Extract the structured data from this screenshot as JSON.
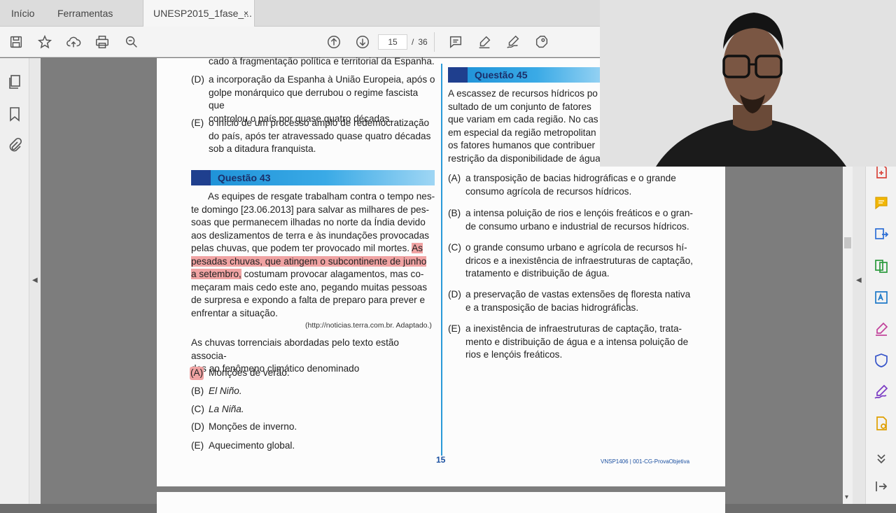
{
  "tabs": {
    "home": "Início",
    "tools": "Ferramentas",
    "document": "UNESP2015_1fase_...",
    "close": "×"
  },
  "toolbar": {
    "page_current": "15",
    "page_sep": "/",
    "page_total": "36"
  },
  "left_column": {
    "top_line": "cado à fragmentação política e territorial da Espanha.",
    "opt_d_label": "(D)",
    "opt_d_lines": [
      "a incorporação da Espanha à União Europeia, após o",
      "golpe monárquico que derrubou o regime fascista que",
      "controlou o país por quase quatro décadas."
    ],
    "opt_e_label": "(E)",
    "opt_e_lines": [
      "o início de um processo amplo de redemocratização",
      "do país, após ter atravessado quase quatro décadas",
      "sob a ditadura franquista."
    ],
    "question_title": "Questão 43",
    "passage_1": "As equipes de resgate trabalham contra o tempo nes-",
    "passage_2": "te domingo [23.06.2013] para salvar as milhares de pes-",
    "passage_3": "soas que permanecem ilhadas no norte da Índia devido",
    "passage_4": "aos deslizamentos de terra e às inundações provocadas",
    "passage_5a": "pelas chuvas, que podem ter provocado mil mortes.",
    "passage_5b": "As",
    "passage_6": "pesadas chuvas, que atingem o subcontinente de junho",
    "passage_7a": "a setembro,",
    "passage_7b": "costumam provocar alagamentos, mas co-",
    "passage_8": "meçaram mais cedo este ano, pegando muitas pessoas",
    "passage_9": "de surpresa e expondo a falta de preparo para prever e",
    "passage_10": "enfrentar a situação.",
    "source": "(http://noticias.terra.com.br. Adaptado.)",
    "stem_1": "As chuvas torrenciais abordadas pelo texto estão associa-",
    "stem_2": "das ao fenômeno climático denominado",
    "answers": [
      {
        "label": "(A)",
        "text": "Monções de verão."
      },
      {
        "label": "(B)",
        "text": "El Niño."
      },
      {
        "label": "(C)",
        "text": "La Niña."
      },
      {
        "label": "(D)",
        "text": "Monções de inverno."
      },
      {
        "label": "(E)",
        "text": "Aquecimento global."
      }
    ]
  },
  "right_column": {
    "question_title": "Questão 45",
    "intro_lines": [
      "A escassez de recursos hídricos po",
      "sultado de um conjunto de fatores",
      "que variam em cada região. No cas",
      "em especial da região metropolitan",
      "os fatores humanos que contribuer",
      "restrição da disponibilidade de água"
    ],
    "answers": [
      {
        "label": "(A)",
        "lines": [
          "a transposição de bacias hidrográficas e o grande",
          "consumo agrícola de recursos hídricos."
        ]
      },
      {
        "label": "(B)",
        "lines": [
          "a intensa poluição de rios e lençóis freáticos e o gran-",
          "de consumo urbano e industrial de recursos hídricos."
        ]
      },
      {
        "label": "(C)",
        "lines": [
          "o grande consumo urbano e agrícola de recursos hí-",
          "dricos e a inexistência de infraestruturas de captação,",
          "tratamento e distribuição de água."
        ]
      },
      {
        "label": "(D)",
        "lines": [
          "a preservação de vastas extensões de floresta nativa",
          "e a transposição de bacias hidrográficas."
        ]
      },
      {
        "label": "(E)",
        "lines": [
          "a inexistência de infraestruturas de captação, trata-",
          "mento e distribuição de água e a intensa poluição de",
          "rios e lençóis freáticos."
        ]
      }
    ]
  },
  "footer": {
    "page_number": "15",
    "code": "VNSP1406 | 001-CG-ProvaObjetiva"
  },
  "colors": {
    "highlight": "#f0a3a3",
    "question_bar": "#1b8fd6",
    "divider": "#2a9ad8"
  }
}
